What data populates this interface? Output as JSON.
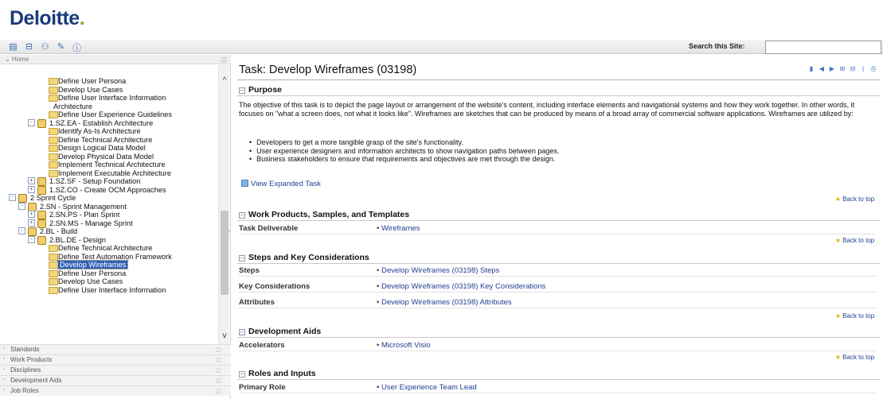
{
  "brand": {
    "logo_text": "Deloitte",
    "logo_dot": "."
  },
  "toolbar": {
    "icons": [
      "tree-view-icon",
      "collapse-icon",
      "sitemap-icon",
      "glossary-icon",
      "info-icon"
    ],
    "search_label": "Search this Site:",
    "search_value": ""
  },
  "nav": {
    "home_label": "Home",
    "tree": [
      {
        "label": "Define User Persona",
        "indent": 4,
        "kind": "folder"
      },
      {
        "label": "Develop Use Cases",
        "indent": 4,
        "kind": "folder"
      },
      {
        "label": "Define User Interface Information",
        "indent": 4,
        "kind": "folder"
      },
      {
        "label": "Architecture",
        "indent": 5,
        "kind": "text"
      },
      {
        "label": "Define User Experience Guidelines",
        "indent": 4,
        "kind": "folder"
      },
      {
        "label": "1.SZ.EA - Establish Architecture",
        "indent": 3,
        "kind": "gear",
        "expand": "-"
      },
      {
        "label": "Identify As-Is Architecture",
        "indent": 4,
        "kind": "folder"
      },
      {
        "label": "Define Technical Architecture",
        "indent": 4,
        "kind": "folder"
      },
      {
        "label": "Design Logical Data Model",
        "indent": 4,
        "kind": "folder"
      },
      {
        "label": "Develop Physical Data Model",
        "indent": 4,
        "kind": "folder"
      },
      {
        "label": "Implement Technical Architecture",
        "indent": 4,
        "kind": "folder"
      },
      {
        "label": "Implement Executable Architecture",
        "indent": 4,
        "kind": "folder"
      },
      {
        "label": "1.SZ.SF - Setup Foundation",
        "indent": 3,
        "kind": "gear",
        "expand": "+"
      },
      {
        "label": "1.SZ.CO - Create OCM Approaches",
        "indent": 3,
        "kind": "gear",
        "expand": "+"
      },
      {
        "label": "2 Sprint Cycle",
        "indent": 1,
        "kind": "gear",
        "expand": "-"
      },
      {
        "label": "2.SN - Sprint Management",
        "indent": 2,
        "kind": "gear",
        "expand": "-"
      },
      {
        "label": "2.SN.PS - Plan Sprint",
        "indent": 3,
        "kind": "gear",
        "expand": "+"
      },
      {
        "label": "2.SN.MS - Manage Sprint",
        "indent": 3,
        "kind": "gear",
        "expand": "+"
      },
      {
        "label": "2.BL - Build",
        "indent": 2,
        "kind": "gear",
        "expand": "-"
      },
      {
        "label": "2.BL.DE - Design",
        "indent": 3,
        "kind": "gear",
        "expand": "-"
      },
      {
        "label": "Define Technical Architecture",
        "indent": 4,
        "kind": "folder"
      },
      {
        "label": "Define Test Automation Framework",
        "indent": 4,
        "kind": "folder"
      },
      {
        "label": "Develop Wireframes",
        "indent": 4,
        "kind": "folder",
        "selected": true
      },
      {
        "label": "Define User Persona",
        "indent": 4,
        "kind": "folder"
      },
      {
        "label": "Develop Use Cases",
        "indent": 4,
        "kind": "folder"
      },
      {
        "label": "Define User Interface Information",
        "indent": 4,
        "kind": "folder"
      }
    ],
    "accordion": [
      "Standards",
      "Work Products",
      "Disciplines",
      "Development Aids",
      "Job Roles"
    ]
  },
  "task": {
    "title": "Task: Develop Wireframes (03198)",
    "purpose_heading": "Purpose",
    "purpose_text": "The objective of this task is to depict the page layout or arrangement of the website's content, including interface elements and navigational systems and how they work together. In other words, it focuses on \"what a screen does, not what it looks like\". Wireframes are sketches that can be produced by means of a broad array of commercial software applications. Wireframes are utilized by:",
    "bullets": [
      "Developers to get a more tangible grasp of the site's functionality.",
      "User experience designers and information architects to show navigation paths between pages.",
      "Business stakeholders to ensure that requirements and objectives are met through the design."
    ],
    "view_expanded": "View Expanded Task",
    "back_to_top": "Back to top",
    "sections": {
      "work_products": {
        "heading": "Work Products, Samples, and Templates",
        "rows": [
          {
            "key": "Task Deliverable",
            "value": "Wireframes"
          }
        ]
      },
      "steps": {
        "heading": "Steps and Key Considerations",
        "rows": [
          {
            "key": "Steps",
            "value": "Develop Wireframes (03198) Steps"
          },
          {
            "key": "Key Considerations",
            "value": "Develop Wireframes (03198) Key Considerations"
          },
          {
            "key": "Attributes",
            "value": "Develop Wireframes (03198) Attributes"
          }
        ]
      },
      "dev_aids": {
        "heading": "Development Aids",
        "rows": [
          {
            "key": "Accelerators",
            "value": "Microsoft Visio"
          }
        ]
      },
      "roles": {
        "heading": "Roles and Inputs",
        "rows": [
          {
            "key": "Primary Role",
            "value": "User Experience Team Lead"
          }
        ]
      }
    }
  }
}
